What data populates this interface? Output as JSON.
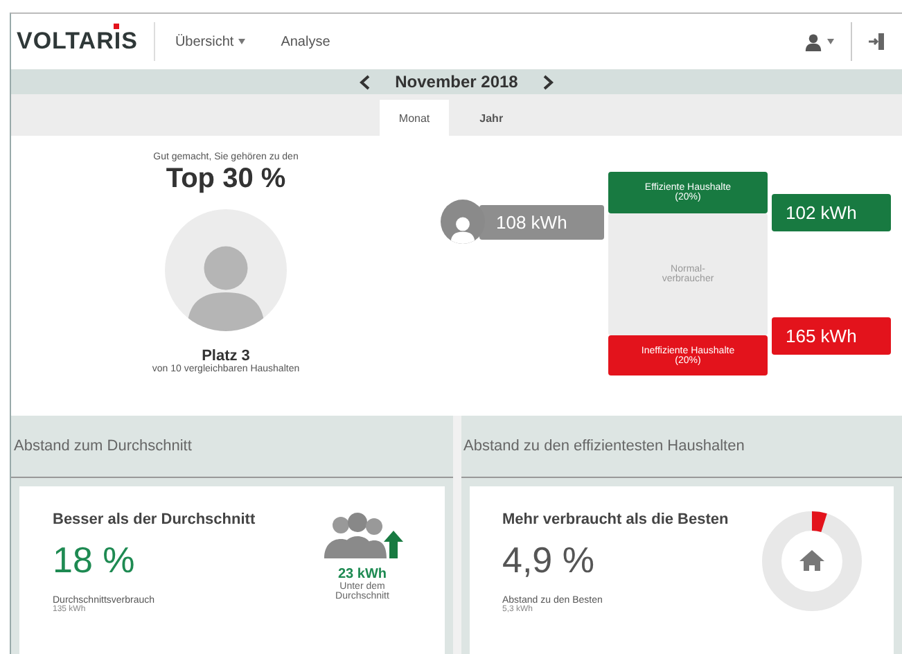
{
  "nav": {
    "logo": "VOLTARIS",
    "items": [
      {
        "label": "Übersicht",
        "kind": "dropdown"
      },
      {
        "label": "Analyse",
        "kind": "link"
      }
    ]
  },
  "period": {
    "label": "November 2018"
  },
  "tabs": [
    {
      "label": "Monat",
      "selected": true
    },
    {
      "label": "Jahr",
      "selected": false
    }
  ],
  "ranking": {
    "intro": "Gut gemacht, Sie gehören zu den",
    "headline": "Top 30 %",
    "place": "Platz 3",
    "subtitle": "von 10 vergleichbaren Haushalten"
  },
  "comparison": {
    "user_value": "108 kWh",
    "groups": [
      {
        "kind": "efficient",
        "label": "Effiziente Haushalte (20%)",
        "value": "102 kWh",
        "color": "#187a41"
      },
      {
        "kind": "normal",
        "label": "Normal-verbraucher"
      },
      {
        "kind": "inefficient",
        "label": "Ineffiziente Haushalte (20%)",
        "value": "165 kWh",
        "color": "#e3131c"
      }
    ]
  },
  "sections": [
    {
      "title": "Abstand zum Durchschnitt",
      "heading": "Besser als der Durchschnitt",
      "value": "18 %",
      "positive": true,
      "caption": "Durchschnittsverbrauch",
      "caption_value": "135 kWh",
      "side": {
        "kind": "people",
        "value": "23 kWh",
        "caption": "Unter dem Durchschnitt"
      }
    },
    {
      "title": "Abstand zu den effizientesten Haushalten",
      "heading": "Mehr verbraucht als die Besten",
      "value": "4,9 %",
      "positive": false,
      "caption": "Abstand zu den Besten",
      "caption_value": "5,3 kWh",
      "side": {
        "kind": "gauge",
        "level": 0.049
      }
    }
  ]
}
